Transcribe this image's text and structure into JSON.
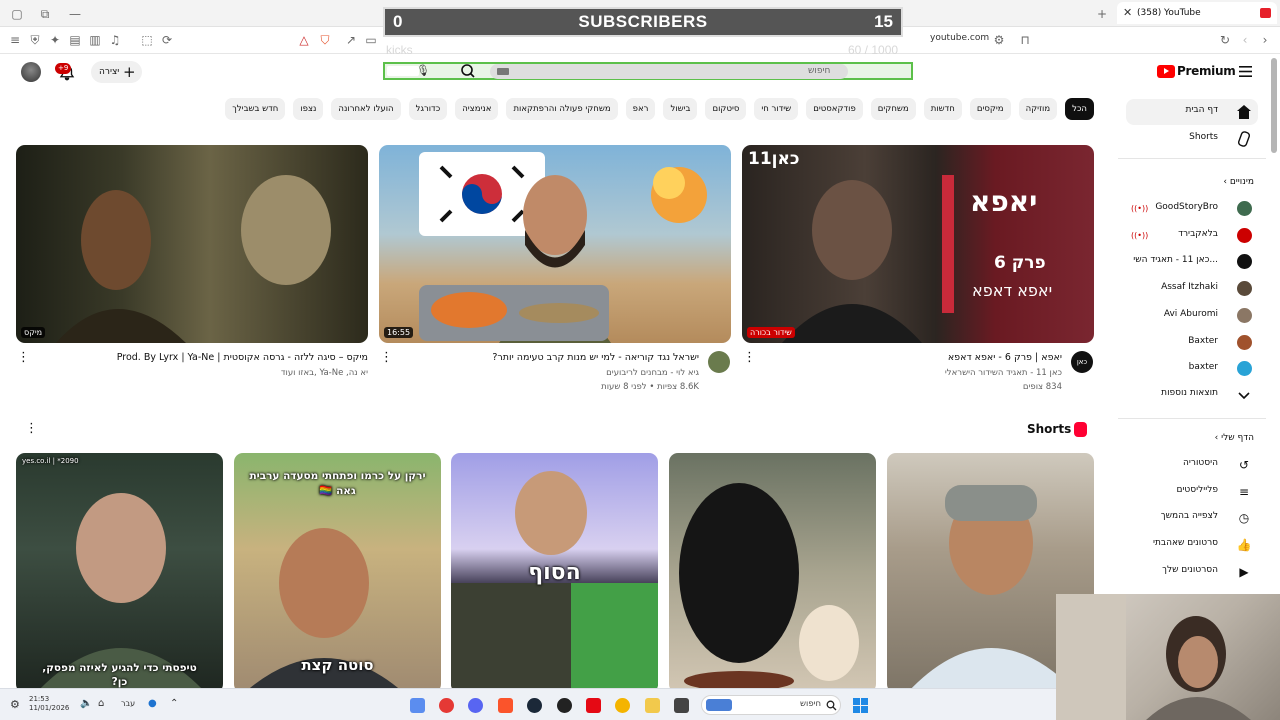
{
  "browser": {
    "tab_title": "(358) YouTube",
    "url": "youtube.com"
  },
  "overlay": {
    "left": "0",
    "center": "SUBSCRIBERS",
    "right": "15",
    "goal_label": "kicks",
    "goal_count": "60 / 1000",
    "goal_progress": 0.06
  },
  "header": {
    "logo_text": "Premium",
    "search_placeholder": "חיפוש",
    "create_label": "יצירה",
    "notif_badge": "+9"
  },
  "chips": [
    "הכל",
    "מוזיקה",
    "מיקסים",
    "חדשות",
    "משחקים",
    "פודקאסטים",
    "שידור חי",
    "סיטקום",
    "בישול",
    "ראפ",
    "משחקי פעולה והרפתקאות",
    "אנימציה",
    "כדורגל",
    "הועלו לאחרונה",
    "נצפו",
    "חדש בשבילך"
  ],
  "videos": [
    {
      "title": "יאפא | פרק 6 - יאפא דאפא",
      "channel": "כאן 11 - תאגיד השידור הישראלי",
      "meta": "834 צופים",
      "badge": "שידור בכורה",
      "thumb_text_1": "כאן11",
      "thumb_text_2": "יאפא",
      "thumb_text_3": "פרק 6",
      "thumb_text_4": "יאפא דאפא",
      "avatar_text": "כאן"
    },
    {
      "title": "ישראל נגד קוריאה - למי יש מנות קרב טעימה יותר?",
      "channel": "גיא לוי - מבחנים לריבועים",
      "meta": "8.6K צפיות • לפני 8 שעות",
      "duration": "16:55"
    },
    {
      "title": "מיקס – סיגה ללזה - גרסה אקוסטית | Prod. By Lyrx | Ya-Ne",
      "channel": "יא נה, Ya-Ne ,באזו ועוד",
      "meta": "",
      "badge": "מיקס"
    }
  ],
  "shorts": {
    "title": "Shorts",
    "items": [
      {
        "caption": "טיפסתי כדי להגיע לאיזה מפסק, כן?",
        "top_text": "2090* | yes.co.il"
      },
      {
        "caption": "סוטה קצת",
        "top_text": "ירקן על כרמו ופתחתי מסעדה ערבית גאה 🏳️‍🌈"
      },
      {
        "caption": "הסוף",
        "top_text": ""
      },
      {
        "caption": "",
        "top_text": ""
      },
      {
        "caption": "",
        "top_text": ""
      }
    ]
  },
  "sidebar": {
    "home": "דף הבית",
    "shorts": "Shorts",
    "subscriptions_head": "מינויים",
    "subscriptions": [
      {
        "name": "GoodStoryBro",
        "live": true,
        "color": "#3f6b4f"
      },
      {
        "name": "בלאקבירד",
        "live": true,
        "color": "#cc0000"
      },
      {
        "name": "כאן 11 - תאגיד השי...",
        "live": false,
        "color": "#111111"
      },
      {
        "name": "Assaf Itzhaki",
        "live": false,
        "color": "#5a4a3a"
      },
      {
        "name": "Avi Aburomi",
        "live": false,
        "color": "#8b7765"
      },
      {
        "name": "Baxter",
        "live": false,
        "color": "#a0522d"
      },
      {
        "name": "baxter",
        "live": false,
        "color": "#29a3d6"
      }
    ],
    "show_more": "תוצאות נוספות",
    "you_head": "הדף שלי",
    "you_items": [
      "היסטוריה",
      "פלייליסטים",
      "לצפייה בהמשך",
      "סרטונים שאהבתי",
      "הסרטונים שלך"
    ]
  },
  "taskbar": {
    "time": "21:53",
    "date": "11/01/2026",
    "lang": "עבר",
    "search_placeholder": "חיפוש"
  }
}
